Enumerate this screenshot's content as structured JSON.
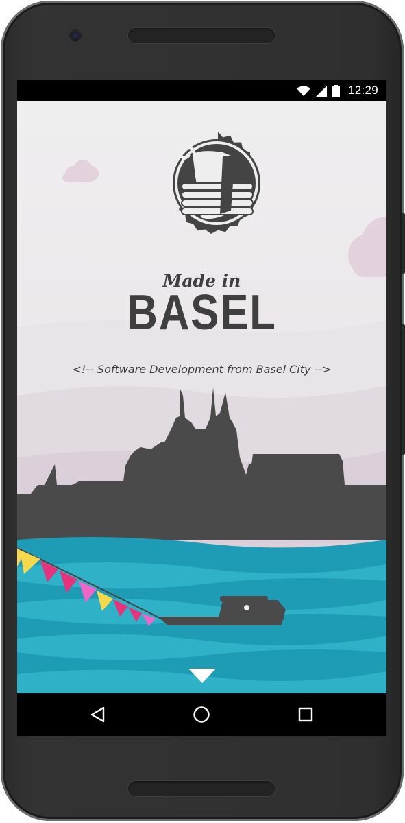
{
  "status_bar": {
    "time": "12:29",
    "icons": [
      "wifi-icon",
      "cell-signal-icon",
      "battery-icon"
    ]
  },
  "app": {
    "logo_icon": "basel-staff-badge-icon",
    "made_in": "Made in",
    "brand": "BASEL",
    "tagline": "<!-- Software Development from Basel City -->",
    "scroll_down_icon": "triangle-down-icon"
  },
  "nav_bar": {
    "icons": [
      "back-triangle-icon",
      "home-circle-icon",
      "recents-square-icon"
    ]
  },
  "colors": {
    "sky": "#efeeef",
    "skyline": "#4a4a4a",
    "river": "#1e9bb5",
    "bunting_yellow": "#f5d94a",
    "bunting_pink": "#e8327a",
    "bunting_magenta": "#ee66c8"
  }
}
